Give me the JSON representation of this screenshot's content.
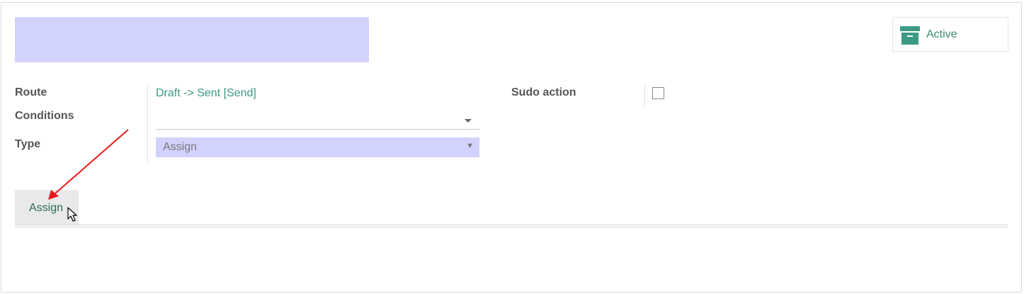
{
  "header": {
    "active_button": {
      "label": "Active",
      "icon": "archive-box-icon",
      "color": "#3c8c70"
    }
  },
  "form": {
    "route": {
      "label": "Route",
      "value": "Draft -> Sent [Send]"
    },
    "conditions": {
      "label": "Conditions",
      "value": ""
    },
    "type": {
      "label": "Type",
      "value": "Assign"
    },
    "sudo_action": {
      "label": "Sudo action",
      "checked": false
    }
  },
  "tabs": [
    {
      "label": "Assign",
      "active": true
    }
  ],
  "colors": {
    "required_field_bg": "#d2d2ff",
    "link": "#3c9a83",
    "annotation_arrow": "#e8191c"
  }
}
